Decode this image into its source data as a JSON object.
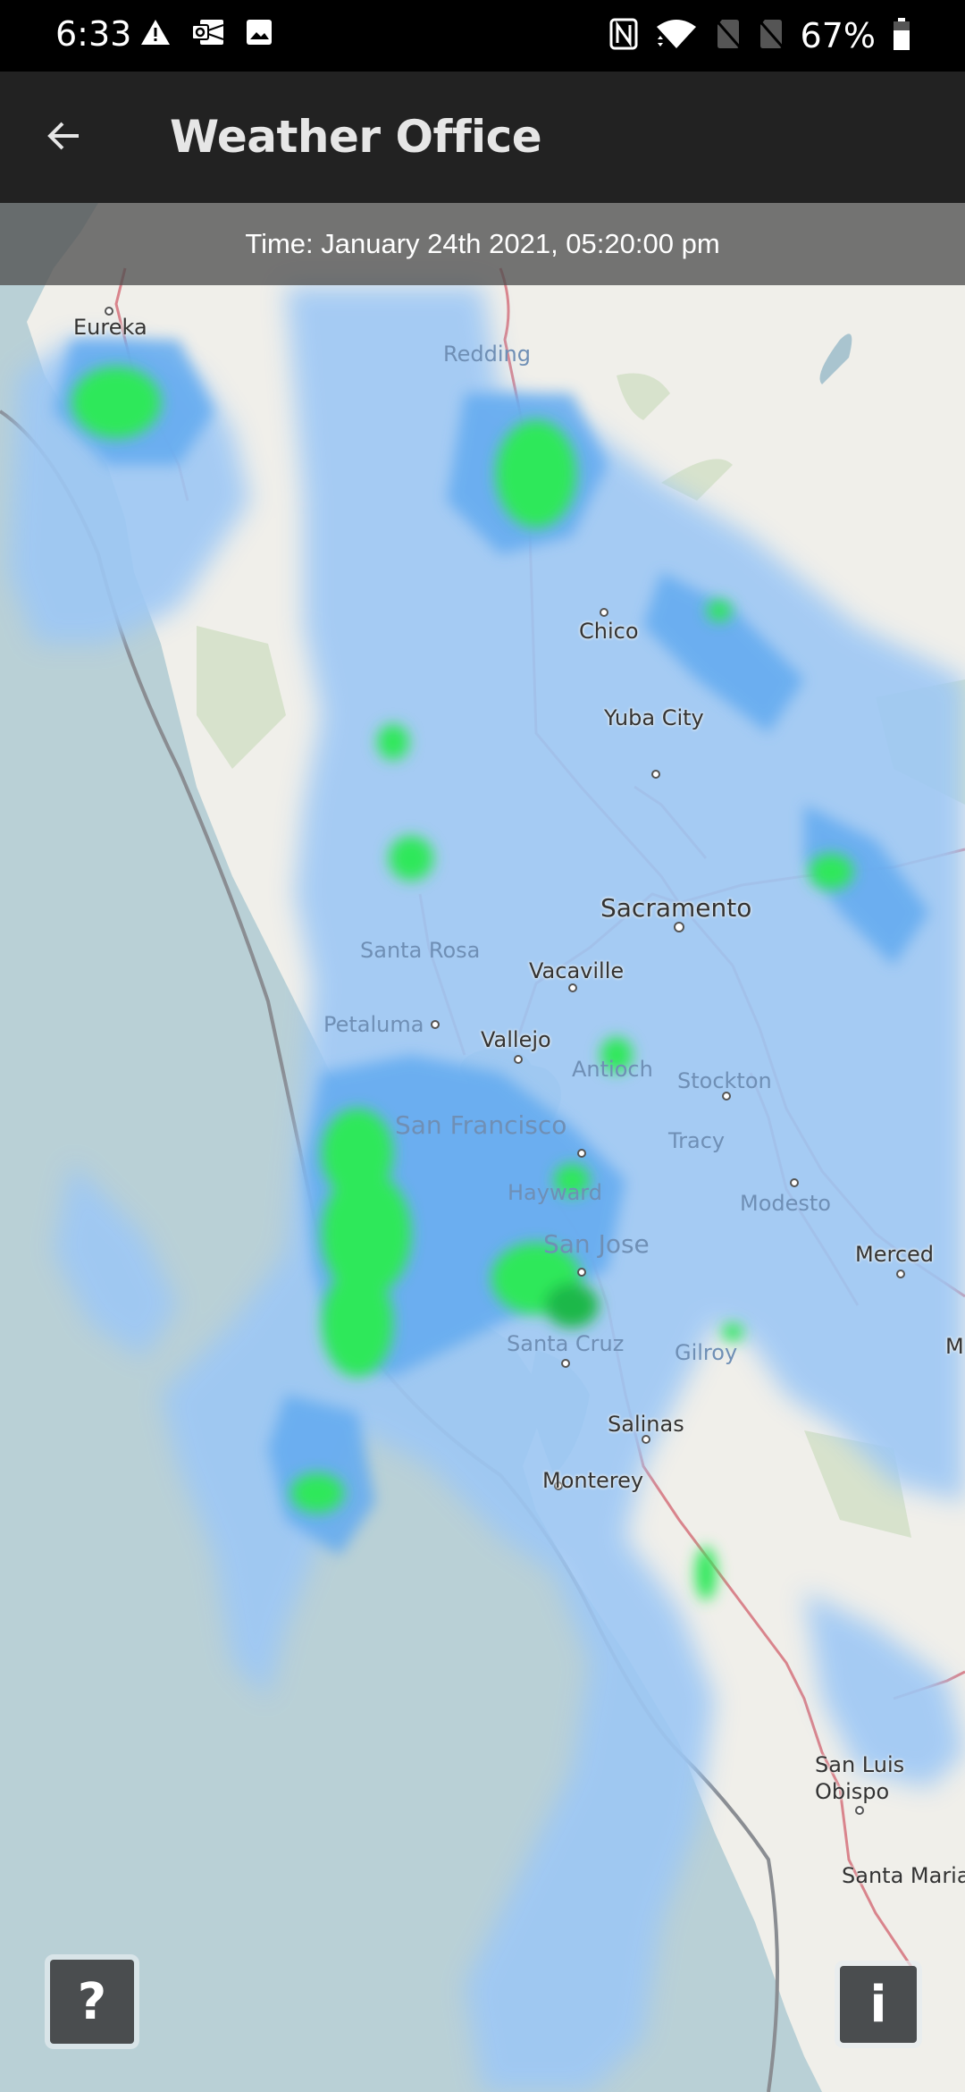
{
  "status_bar": {
    "time": "6:33",
    "left_icons": [
      "warning-icon",
      "outlook-icon",
      "image-icon"
    ],
    "right_icons": [
      "nfc-icon",
      "wifi-icon",
      "no-sim-icon",
      "no-sim-icon"
    ],
    "battery_percent": "67%",
    "battery_level": 0.67
  },
  "app_bar": {
    "back_icon": "arrow-left-icon",
    "title": "Weather Office"
  },
  "map": {
    "time_banner": "Time: January 24th 2021, 05:20:00 pm",
    "layer": "precipitation-radar",
    "colors": {
      "ocean": "#b9d0d6",
      "land": "#f0efea",
      "rain_light": "#9dc8f5",
      "rain_medium": "#5fa8ee",
      "rain_heavy": "#2fe85a",
      "roads": "#d9848c",
      "coastline": "#8a8d92"
    },
    "cities": [
      {
        "name": "Eureka",
        "style": "normal"
      },
      {
        "name": "Redding",
        "style": "faded"
      },
      {
        "name": "Chico",
        "style": "normal"
      },
      {
        "name": "Yuba City",
        "style": "normal"
      },
      {
        "name": "Sacramento",
        "style": "big"
      },
      {
        "name": "Santa Rosa",
        "style": "faded"
      },
      {
        "name": "Vacaville",
        "style": "normal"
      },
      {
        "name": "Petaluma",
        "style": "faded"
      },
      {
        "name": "Vallejo",
        "style": "normal"
      },
      {
        "name": "Antioch",
        "style": "faded"
      },
      {
        "name": "Stockton",
        "style": "faded"
      },
      {
        "name": "San Francisco",
        "style": "faded"
      },
      {
        "name": "Tracy",
        "style": "faded"
      },
      {
        "name": "Hayward",
        "style": "faded"
      },
      {
        "name": "Modesto",
        "style": "faded"
      },
      {
        "name": "San Jose",
        "style": "faded"
      },
      {
        "name": "Merced",
        "style": "normal"
      },
      {
        "name": "Santa Cruz",
        "style": "faded"
      },
      {
        "name": "Gilroy",
        "style": "faded"
      },
      {
        "name": "Salinas",
        "style": "normal"
      },
      {
        "name": "Monterey",
        "style": "normal"
      },
      {
        "name": "San Luis Obispo",
        "style": "normal"
      },
      {
        "name": "Santa Maria",
        "style": "normal"
      },
      {
        "name": "M",
        "style": "normal"
      }
    ],
    "help_button": "?",
    "info_button": "i"
  }
}
